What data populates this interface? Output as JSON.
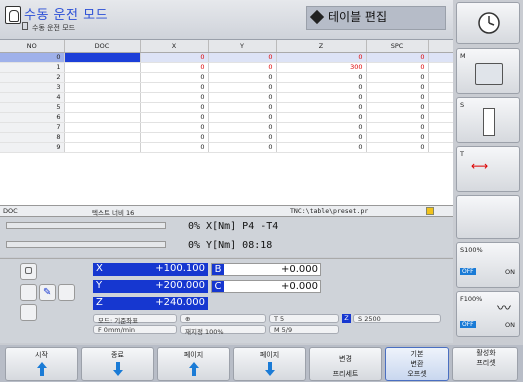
{
  "header": {
    "mode_title": "수동 운전 모드",
    "mode_subtitle": "수동 운전 모드",
    "table_edit": "테이블 편집"
  },
  "table": {
    "columns": [
      "NO",
      "DOC",
      "X",
      "Y",
      "Z",
      "SPC"
    ],
    "rows": [
      {
        "no": "0",
        "doc": "",
        "x": "0",
        "y": "0",
        "z": "0",
        "spc": "0"
      },
      {
        "no": "1",
        "doc": "",
        "x": "0",
        "y": "0",
        "z": "300",
        "spc": "0"
      },
      {
        "no": "2",
        "doc": "",
        "x": "0",
        "y": "0",
        "z": "0",
        "spc": "0"
      },
      {
        "no": "3",
        "doc": "",
        "x": "0",
        "y": "0",
        "z": "0",
        "spc": "0"
      },
      {
        "no": "4",
        "doc": "",
        "x": "0",
        "y": "0",
        "z": "0",
        "spc": "0"
      },
      {
        "no": "5",
        "doc": "",
        "x": "0",
        "y": "0",
        "z": "0",
        "spc": "0"
      },
      {
        "no": "6",
        "doc": "",
        "x": "0",
        "y": "0",
        "z": "0",
        "spc": "0"
      },
      {
        "no": "7",
        "doc": "",
        "x": "0",
        "y": "0",
        "z": "0",
        "spc": "0"
      },
      {
        "no": "8",
        "doc": "",
        "x": "0",
        "y": "0",
        "z": "0",
        "spc": "0"
      },
      {
        "no": "9",
        "doc": "",
        "x": "0",
        "y": "0",
        "z": "0",
        "spc": "0"
      }
    ]
  },
  "status": {
    "field": "DOC",
    "text_width": "텍스트 너비 16",
    "path": "TNC:\\table\\preset.pr"
  },
  "progress": {
    "line1": "0% X[Nm] P4  -T4",
    "line2": "0% Y[Nm] 08:18"
  },
  "axes": [
    {
      "label": "X",
      "value": "+100.100",
      "label2": "B",
      "value2": "+0.000"
    },
    {
      "label": "Y",
      "value": "+200.000",
      "label2": "C",
      "value2": "+0.000"
    },
    {
      "label": "Z",
      "value": "+240.000"
    }
  ],
  "info": {
    "mode": "모드: 기준좌표",
    "feed": "F 0mm/min",
    "override": "재지정 100%",
    "tool": "T 5",
    "spindle": "S 2500",
    "m": "M 5/9"
  },
  "right": {
    "m_label": "M",
    "s_label": "S",
    "t_label": "T",
    "s_override": "S100%",
    "f_override": "F100%",
    "off1": "OFF",
    "on1": "ON",
    "off2": "OFF",
    "on2": "ON"
  },
  "softkeys": {
    "start": "시작",
    "end": "종료",
    "page1": "페이지",
    "page2": "페이지",
    "change1": "변경",
    "change2": "프리세트",
    "base1": "기본",
    "base2": "변환",
    "base3": "오프셋",
    "act1": "활성화",
    "act2": "프리셋",
    "quit": "종료"
  },
  "colors": {
    "accent": "#1637d0",
    "selected_row": "#dde3f6",
    "red_value": "#d00000"
  }
}
